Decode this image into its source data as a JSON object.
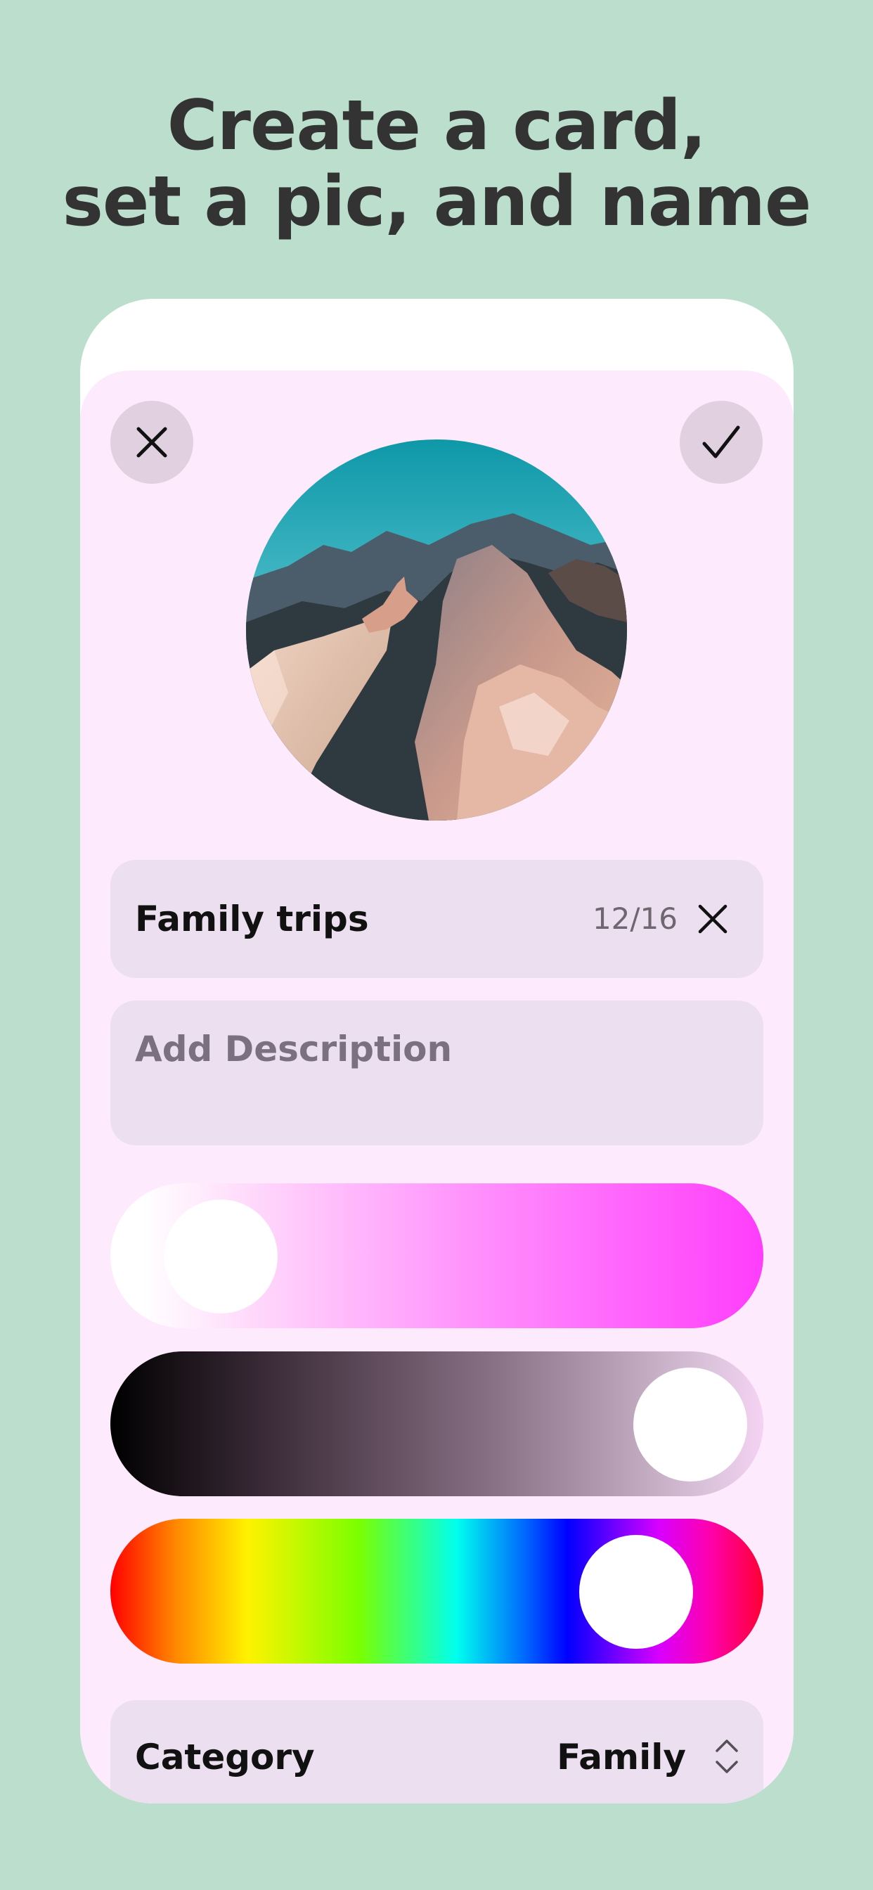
{
  "headline": {
    "line1": "Create a card,",
    "line2": "set a pic, and name"
  },
  "editor": {
    "close_icon": "close-icon",
    "confirm_icon": "checkmark-icon",
    "card_name": {
      "value": "Family trips",
      "counter": "12/16",
      "clear_icon": "close-icon"
    },
    "description": {
      "placeholder": "Add Description"
    },
    "color": {
      "saturation_level": 0.17,
      "brightness_level": 0.87,
      "hue_level": 0.79
    },
    "category": {
      "label": "Category",
      "value": "Family",
      "icon": "chevron-up-down-icon"
    }
  },
  "colors": {
    "background": "#bcdfcd",
    "sheet": "#fdeafd",
    "field": "#ecdfef",
    "button": "#e0d0e0"
  }
}
